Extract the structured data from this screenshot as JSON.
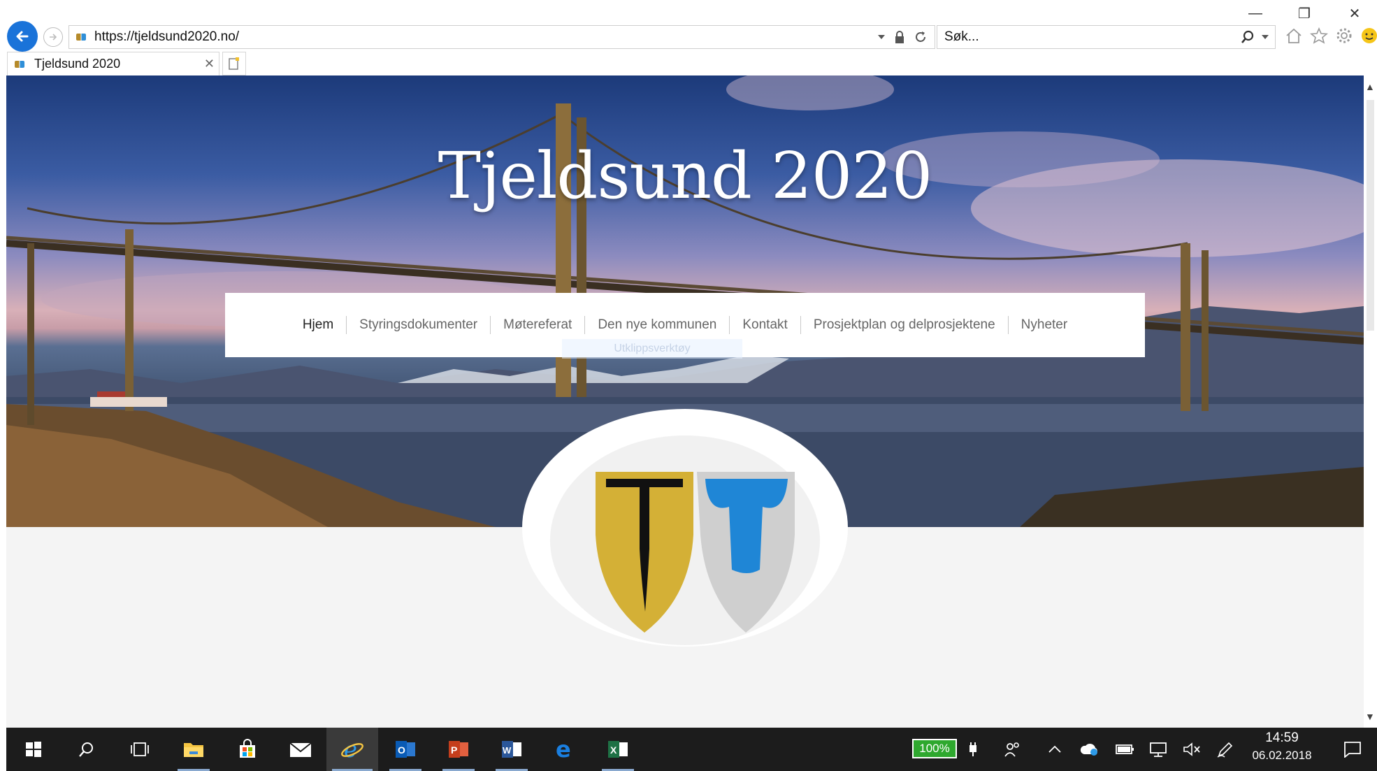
{
  "browser": {
    "window_controls": {
      "minimize": "—",
      "restore": "❐",
      "close": "✕"
    },
    "address_url": "https://tjeldsund2020.no/",
    "search_placeholder": "Søk...",
    "tab_title": "Tjeldsund 2020",
    "tab_close": "✕"
  },
  "site": {
    "title": "Tjeldsund 2020",
    "nav": [
      {
        "label": "Hjem",
        "active": true
      },
      {
        "label": "Styringsdokumenter",
        "active": false
      },
      {
        "label": "Møtereferat",
        "active": false
      },
      {
        "label": "Den nye kommunen",
        "active": false
      },
      {
        "label": "Kontakt",
        "active": false
      },
      {
        "label": "Prosjektplan og delprosjektene",
        "active": false
      },
      {
        "label": "Nyheter",
        "active": false
      }
    ],
    "ghost_overlay_text": "Utklippsverktøy",
    "colors": {
      "gold_shield": "#d4b036",
      "silver_shield": "#cfcfcf",
      "blue_t": "#1f86d6",
      "black_t": "#111111"
    }
  },
  "taskbar": {
    "apps": [
      "start-icon",
      "search-icon",
      "task-view-icon",
      "file-explorer-icon",
      "store-icon",
      "mail-icon",
      "internet-explorer-icon",
      "outlook-icon",
      "powerpoint-icon",
      "word-icon",
      "edge-icon",
      "excel-icon"
    ],
    "battery": "100%",
    "time": "14:59",
    "date": "06.02.2018"
  }
}
